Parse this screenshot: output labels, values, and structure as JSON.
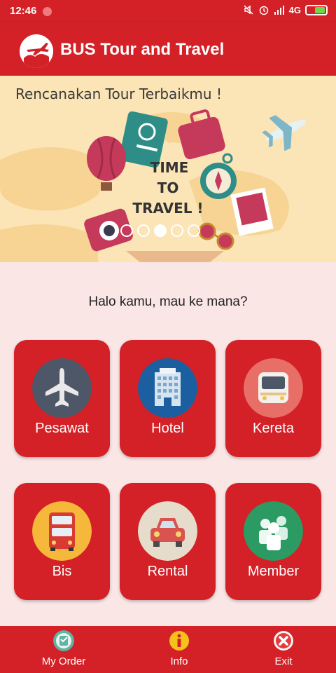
{
  "status_bar": {
    "time": "12:46",
    "network": "4G"
  },
  "app_bar": {
    "title": "BUS Tour and Travel"
  },
  "banner": {
    "heading": "Rencanakan Tour Terbaikmu !",
    "center_text": [
      "TIME",
      "TO",
      "TRAVEL !"
    ],
    "indicator_count": 5,
    "active_indicator": 2
  },
  "greeting": "Halo kamu, mau ke mana?",
  "menu": [
    {
      "label": "Pesawat",
      "icon": "airplane-icon",
      "circle_color": "#4d5768"
    },
    {
      "label": "Hotel",
      "icon": "building-icon",
      "circle_color": "#1b5fa0"
    },
    {
      "label": "Kereta",
      "icon": "train-icon",
      "circle_color": "#e76f67"
    },
    {
      "label": "Bis",
      "icon": "bus-icon",
      "circle_color": "#f6b83a"
    },
    {
      "label": "Rental",
      "icon": "car-icon",
      "circle_color": "#e6dccb"
    },
    {
      "label": "Member",
      "icon": "people-icon",
      "circle_color": "#2b9a63"
    }
  ],
  "bottom_nav": [
    {
      "label": "My Order",
      "icon": "order-icon"
    },
    {
      "label": "Info",
      "icon": "info-icon"
    },
    {
      "label": "Exit",
      "icon": "exit-icon"
    }
  ],
  "colors": {
    "primary": "#d32127",
    "background": "#fbe6e6",
    "banner": "#fbe4b6"
  }
}
